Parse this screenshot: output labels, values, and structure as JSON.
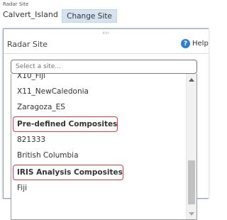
{
  "header": {
    "label": "Radar Site",
    "current_site": "Calvert_Island",
    "change_button": "Change Site"
  },
  "dialog": {
    "title": "Radar Site",
    "help_label": "Help",
    "help_icon": "question-mark",
    "search": {
      "placeholder": "Select a site..."
    },
    "options": {
      "partial_top": "X10_Fiji",
      "opt1": "X11_NewCaledonia",
      "opt2": "Zaragoza_ES",
      "group1": "Pre-defined Composites",
      "opt3": "821333",
      "opt4": "British Columbia",
      "group2": "IRIS Analysis Composites",
      "opt5": "Fiji"
    }
  },
  "colors": {
    "button_bg": "#d5e3f1",
    "highlight_border": "#e03c3c",
    "help_icon": "#2f7fd0"
  }
}
